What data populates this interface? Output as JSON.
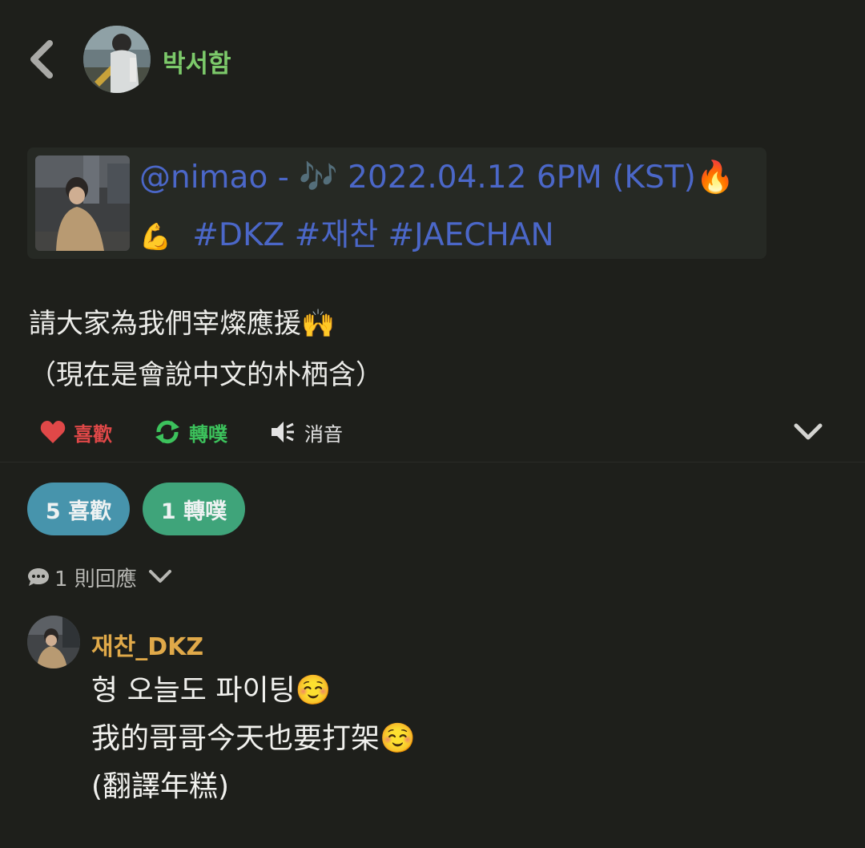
{
  "note": {
    "author": "박서함",
    "quote": {
      "line1": "@nimao - 🎶 2022.04.12 6PM (KST)🔥",
      "line2_emoji": "💪",
      "line2_tags": "#DKZ #재찬 #JAECHAN"
    },
    "text": "請大家為我們宰燦應援🙌\n（現在是會說中文的朴栖含）"
  },
  "actions": {
    "like": "喜歡",
    "renote": "轉噗",
    "mute": "消音"
  },
  "stats": {
    "likes": "5 喜歡",
    "renotes": "1 轉噗"
  },
  "replies": {
    "label": "1 則回應"
  },
  "reply": {
    "author": "재찬_DKZ",
    "text": "형 오늘도 파이팅☺️\n我的哥哥今天也要打架☺️\n(翻譯年糕)"
  },
  "colors": {
    "background": "#1e1f1b",
    "author": "#7cc96a",
    "quote_link": "#4b67c8",
    "like": "#e04848",
    "renote": "#3cc25c",
    "pill_likes": "#4794ac",
    "pill_renotes": "#3fa47a",
    "reply_author": "#e0a949"
  },
  "icons": [
    "back-chevron-icon",
    "heart-icon",
    "renote-icon",
    "mute-speaker-icon",
    "chevron-down-icon",
    "comment-bubble-icon"
  ]
}
